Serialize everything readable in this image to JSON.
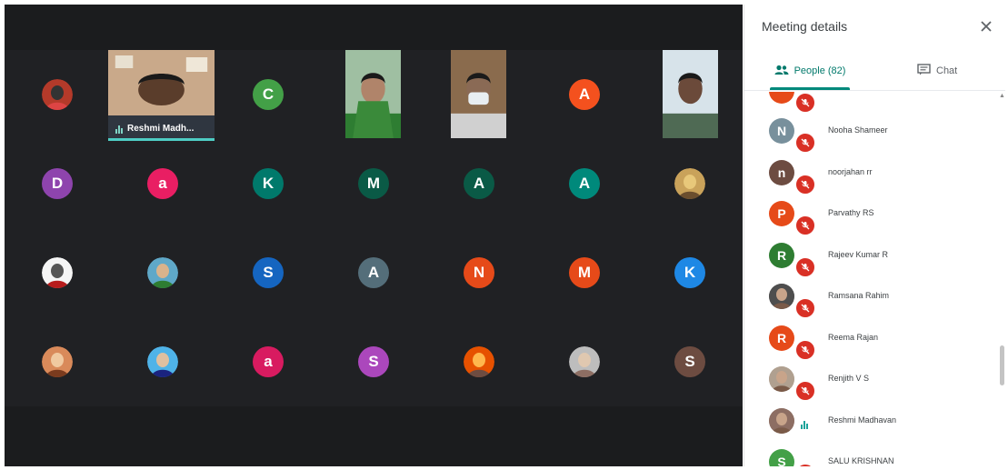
{
  "grid": {
    "tiles": [
      {
        "kind": "photo",
        "icon": "participant-photo-icon",
        "colors": [
          "#b43a2a",
          "#d44",
          "#333"
        ]
      },
      {
        "kind": "video",
        "name": "Reshmi Madh...",
        "speaking": true,
        "icon": "participant-video-icon"
      },
      {
        "kind": "letter",
        "letter": "C",
        "color": "#43a047"
      },
      {
        "kind": "video",
        "name": "",
        "icon": "participant-video-icon"
      },
      {
        "kind": "video",
        "name": "",
        "icon": "participant-video-icon"
      },
      {
        "kind": "letter",
        "letter": "A",
        "color": "#f4511e"
      },
      {
        "kind": "video",
        "name": "",
        "icon": "participant-video-icon"
      },
      {
        "kind": "letter",
        "letter": "D",
        "color": "#8e44ad"
      },
      {
        "kind": "letter",
        "letter": "a",
        "color": "#e91e63"
      },
      {
        "kind": "letter",
        "letter": "K",
        "color": "#00796b"
      },
      {
        "kind": "letter",
        "letter": "M",
        "color": "#0a5a46"
      },
      {
        "kind": "letter",
        "letter": "A",
        "color": "#0a5a46"
      },
      {
        "kind": "letter",
        "letter": "A",
        "color": "#00897b"
      },
      {
        "kind": "photo",
        "icon": "participant-photo-icon",
        "colors": [
          "#c9a25a",
          "#6b4e2e",
          "#e8c87a"
        ]
      },
      {
        "kind": "photo",
        "icon": "participant-photo-icon",
        "colors": [
          "#f5f5f5",
          "#b71c1c",
          "#555"
        ]
      },
      {
        "kind": "photo",
        "icon": "participant-photo-icon",
        "colors": [
          "#5fa8c8",
          "#2e7d32",
          "#d9b38c"
        ]
      },
      {
        "kind": "letter",
        "letter": "S",
        "color": "#1565c0"
      },
      {
        "kind": "letter",
        "letter": "A",
        "color": "#546e7a"
      },
      {
        "kind": "letter",
        "letter": "N",
        "color": "#e64a19"
      },
      {
        "kind": "letter",
        "letter": "M",
        "color": "#e64a19"
      },
      {
        "kind": "letter",
        "letter": "K",
        "color": "#1e88e5"
      },
      {
        "kind": "photo",
        "icon": "participant-photo-icon",
        "colors": [
          "#d98a5a",
          "#7a3b1e",
          "#f0c9a0"
        ]
      },
      {
        "kind": "photo",
        "icon": "participant-photo-icon",
        "colors": [
          "#4fb3e8",
          "#1a237e",
          "#e0c0a0"
        ]
      },
      {
        "kind": "letter",
        "letter": "a",
        "color": "#d81b60"
      },
      {
        "kind": "letter",
        "letter": "S",
        "color": "#ab47bc"
      },
      {
        "kind": "photo",
        "icon": "participant-photo-icon",
        "colors": [
          "#e65100",
          "#6d4c41",
          "#ffb74d"
        ]
      },
      {
        "kind": "photo",
        "icon": "participant-photo-icon",
        "colors": [
          "#bdbdbd",
          "#8d6e63",
          "#e0c8b0"
        ]
      },
      {
        "kind": "letter",
        "letter": "S",
        "color": "#6d4c41"
      }
    ]
  },
  "panel": {
    "title": "Meeting details",
    "close_icon": "close-icon",
    "tabs": {
      "people_label": "People (82)",
      "chat_label": "Chat"
    },
    "people": [
      {
        "name": "",
        "letter": "",
        "color": "#e64a19",
        "muted": true,
        "partial": true
      },
      {
        "name": "Nooha Shameer",
        "letter": "N",
        "color": "#78909c",
        "muted": true
      },
      {
        "name": "noorjahan rr",
        "letter": "n",
        "color": "#6d4c41",
        "muted": true
      },
      {
        "name": "Parvathy RS",
        "letter": "P",
        "color": "#e64a19",
        "muted": true
      },
      {
        "name": "Rajeev Kumar R",
        "letter": "R",
        "color": "#2e7d32",
        "muted": true
      },
      {
        "name": "Ramsana Rahim",
        "letter": "",
        "color": "#4e4e4e",
        "photo": true,
        "muted": true
      },
      {
        "name": "Reema Rajan",
        "letter": "R",
        "color": "#e64a19",
        "muted": true
      },
      {
        "name": "Renjith V S",
        "letter": "",
        "color": "#b0a090",
        "photo": true,
        "muted": true
      },
      {
        "name": "Reshmi Madhavan",
        "letter": "",
        "color": "#8d6e63",
        "photo": true,
        "muted": false,
        "speaking": true
      },
      {
        "name": "SALU KRISHNAN",
        "letter": "S",
        "color": "#43a047",
        "muted": true
      }
    ]
  }
}
